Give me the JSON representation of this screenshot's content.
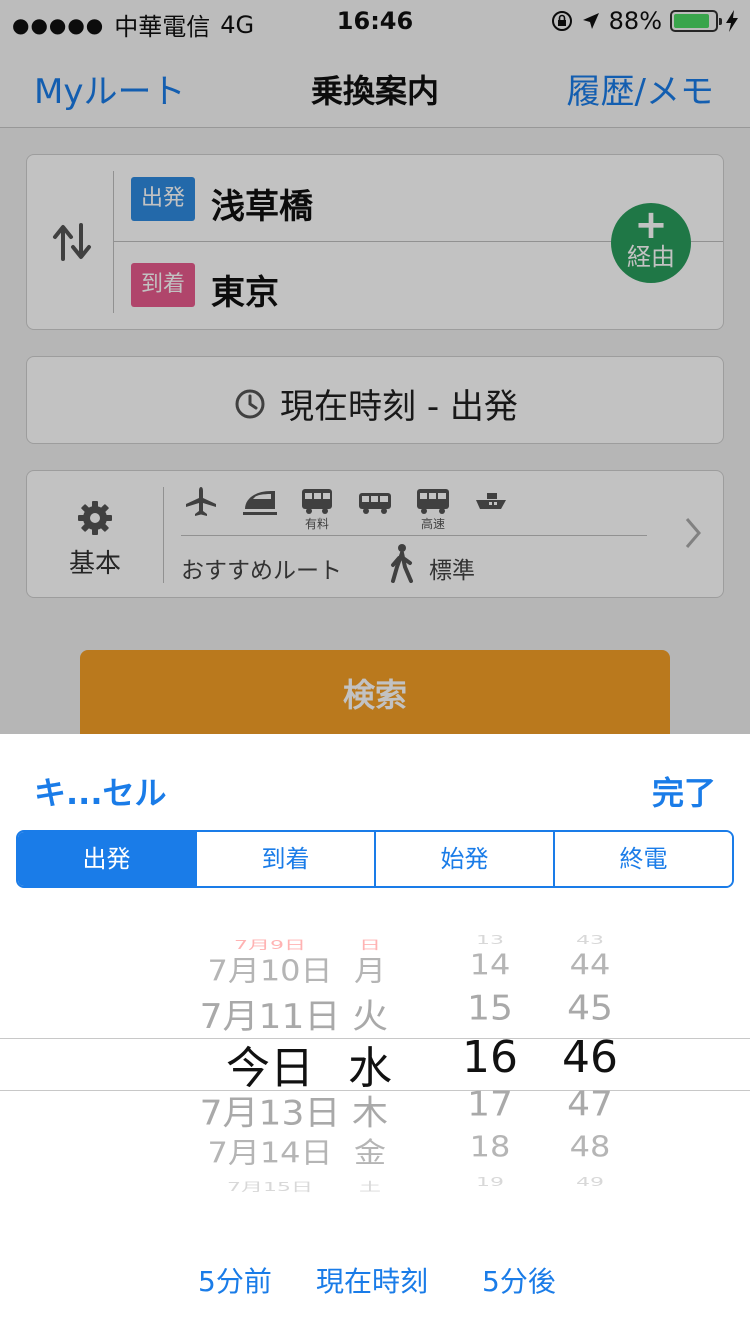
{
  "status_bar": {
    "signal_dots": "●●●●●",
    "carrier": "中華電信",
    "network": "4G",
    "time": "16:46",
    "battery_percent": "88%",
    "battery_level": 0.88,
    "battery_color": "#4cd964"
  },
  "nav": {
    "left_label": "Myルート",
    "title": "乗換案内",
    "right_label": "履歴/メモ"
  },
  "route": {
    "departure_badge": "出発",
    "departure_station": "浅草橋",
    "arrival_badge": "到着",
    "arrival_station": "東京",
    "via_plus": "+",
    "via_label": "経由",
    "colors": {
      "departure": "#2f8ae0",
      "arrival": "#e85b8d",
      "via": "#2a9d5c"
    }
  },
  "time_button": {
    "label": "現在時刻 - 出発"
  },
  "options": {
    "settings_label": "基本",
    "modes": [
      {
        "icon": "airplane-icon",
        "sub": ""
      },
      {
        "icon": "shinkansen-icon",
        "sub": ""
      },
      {
        "icon": "paid-express-icon",
        "sub": "有料"
      },
      {
        "icon": "bus-icon",
        "sub": ""
      },
      {
        "icon": "highway-bus-icon",
        "sub": "高速"
      },
      {
        "icon": "ferry-icon",
        "sub": ""
      }
    ],
    "route_type": "おすすめルート",
    "walk_speed": "標準"
  },
  "search_button": {
    "label": "検索",
    "color": "#f59f27"
  },
  "sheet": {
    "cancel_label": "キ...セル",
    "done_label": "完了",
    "segments": [
      {
        "label": "出発",
        "active": true
      },
      {
        "label": "到着",
        "active": false
      },
      {
        "label": "始発",
        "active": false
      },
      {
        "label": "終電",
        "active": false
      }
    ],
    "picker": {
      "dates": [
        "7月9日",
        "7月10日",
        "7月11日",
        "今日",
        "7月13日",
        "7月14日",
        "7月15日"
      ],
      "weekdays": [
        "日",
        "月",
        "火",
        "水",
        "木",
        "金",
        "土"
      ],
      "hours": [
        "13",
        "14",
        "15",
        "16",
        "17",
        "18",
        "19"
      ],
      "minutes": [
        "43",
        "44",
        "45",
        "46",
        "47",
        "48",
        "49"
      ],
      "selected": {
        "date": "今日",
        "weekday": "水",
        "hour": "16",
        "minute": "46"
      }
    },
    "quick_buttons": [
      "5分前",
      "現在時刻",
      "5分後"
    ]
  },
  "accent_color": "#1a7ce8"
}
